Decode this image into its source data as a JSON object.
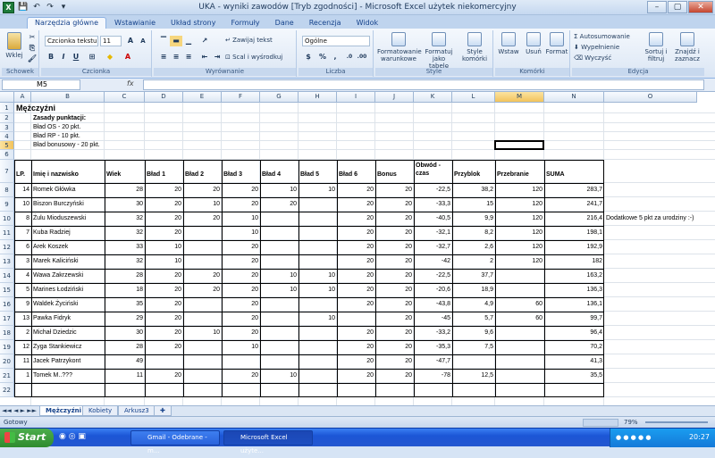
{
  "window": {
    "title": "UKA - wyniki zawodów  [Tryb zgodności] - Microsoft Excel użytek niekomercyjny",
    "app_icon": "X",
    "qat_icons": [
      "save-icon",
      "undo-icon",
      "redo-icon",
      "qat-dropdown-icon"
    ],
    "controls": [
      "–",
      "▢",
      "✕"
    ]
  },
  "ribbon": {
    "tabs": [
      "Narzędzia główne",
      "Wstawianie",
      "Układ strony",
      "Formuły",
      "Dane",
      "Recenzja",
      "Widok"
    ],
    "active_tab": 0,
    "paste_label": "Wklej",
    "clipboard_label": "Schowek",
    "font_name": "Czcionka tekstu",
    "font_size": "11",
    "font_label": "Czcionka",
    "align_label": "Wyrównanie",
    "wrap_label": "Zawijaj tekst",
    "merge_label": "Scal i wyśrodkuj",
    "number_format": "Ogólne",
    "number_label": "Liczba",
    "cond_format_label": "Formatowanie warunkowe",
    "format_table_label": "Formatuj jako tabelę",
    "cell_styles_label": "Style komórki",
    "styles_label": "Style",
    "insert_label": "Wstaw",
    "delete_label": "Usuń",
    "format_label": "Format",
    "cells_label": "Komórki",
    "autosum_label": "Autosumowanie",
    "fill_label": "Wypełnienie",
    "clear_label": "Wyczyść",
    "sort_label": "Sortuj i filtruj",
    "find_label": "Znajdź i zaznacz",
    "edit_label": "Edycja",
    "bold": "B",
    "italic": "I",
    "underline": "U"
  },
  "formula_bar": {
    "name_box": "M5",
    "fx": "fx",
    "value": ""
  },
  "columns": [
    "A",
    "B",
    "C",
    "D",
    "E",
    "F",
    "G",
    "H",
    "I",
    "J",
    "K",
    "L",
    "M",
    "N",
    "O"
  ],
  "selected_column": "M",
  "rows": [
    "1",
    "2",
    "3",
    "4",
    "5",
    "6",
    "7",
    "8",
    "9",
    "10",
    "11",
    "12",
    "13",
    "14",
    "15",
    "16",
    "17",
    "18",
    "19",
    "20",
    "21",
    "22"
  ],
  "selected_row": "5",
  "header_block": {
    "title": "Mężczyźni",
    "rules_title": "Zasady punktacji:",
    "rules": [
      "Bład OS - 20 pkt.",
      "Bład RP - 10 pkt.",
      "Bład bonusowy - 20 pkt."
    ]
  },
  "table": {
    "headers": [
      "LP.",
      "Imię i nazwisko",
      "Wiek",
      "Bład 1",
      "Bład 2",
      "Bład 3",
      "Bład 4",
      "Bład 5",
      "Bład 6",
      "Bonus",
      "Obwód - czas",
      "Przyblok",
      "Przebranie",
      "SUMA"
    ],
    "rows": [
      [
        "14",
        "Romek Główka",
        "28",
        "20",
        "20",
        "20",
        "10",
        "10",
        "20",
        "20",
        "-22,5",
        "38,2",
        "120",
        "283,7"
      ],
      [
        "10",
        "Biszon Burczyński",
        "30",
        "20",
        "10",
        "20",
        "20",
        "",
        "20",
        "20",
        "-33,3",
        "15",
        "120",
        "241,7"
      ],
      [
        "8",
        "Żulu Mioduszewski",
        "32",
        "20",
        "20",
        "10",
        "",
        "",
        "20",
        "20",
        "-40,5",
        "9,9",
        "120",
        "216,4"
      ],
      [
        "7",
        "Kuba Radziej",
        "32",
        "20",
        "",
        "10",
        "",
        "",
        "20",
        "20",
        "-32,1",
        "8,2",
        "120",
        "198,1"
      ],
      [
        "6",
        "Arek Koszek",
        "33",
        "10",
        "",
        "20",
        "",
        "",
        "20",
        "20",
        "-32,7",
        "2,6",
        "120",
        "192,9"
      ],
      [
        "3",
        "Marek Kaliciński",
        "32",
        "10",
        "",
        "20",
        "",
        "",
        "20",
        "20",
        "-42",
        "2",
        "120",
        "182"
      ],
      [
        "4",
        "Wawa Zakrzewski",
        "28",
        "20",
        "20",
        "20",
        "10",
        "10",
        "20",
        "20",
        "-22,5",
        "37,7",
        "",
        "163,2"
      ],
      [
        "5",
        "Marines Łodziński",
        "18",
        "20",
        "20",
        "20",
        "10",
        "10",
        "20",
        "20",
        "-20,6",
        "18,9",
        "",
        "136,3"
      ],
      [
        "9",
        "Waldek Życiński",
        "35",
        "20",
        "",
        "20",
        "",
        "",
        "20",
        "20",
        "-43,8",
        "4,9",
        "60",
        "136,1"
      ],
      [
        "13",
        "Pawka Fidryk",
        "29",
        "20",
        "",
        "20",
        "",
        "10",
        "",
        "20",
        "-45",
        "5,7",
        "60",
        "99,7"
      ],
      [
        "2",
        "Michał Dziedzic",
        "30",
        "20",
        "10",
        "20",
        "",
        "",
        "20",
        "20",
        "-33,2",
        "9,6",
        "",
        "96,4"
      ],
      [
        "12",
        "Zyga Stankiewicz",
        "28",
        "20",
        "",
        "10",
        "",
        "",
        "20",
        "20",
        "-35,3",
        "7,5",
        "",
        "70,2"
      ],
      [
        "11",
        "Jacek Patrzykont",
        "49",
        "",
        "",
        "",
        "",
        "",
        "20",
        "20",
        "-47,7",
        "",
        "",
        "41,3"
      ],
      [
        "1",
        "Tomek M..???",
        "11",
        "20",
        "",
        "20",
        "10",
        "",
        "20",
        "20",
        "-78",
        "12,5",
        "",
        "35,5"
      ]
    ],
    "note": "Dodatkowe 5 pkt za urodziny :-)"
  },
  "sheets": [
    "Mężczyźni",
    "Kobiety",
    "Arkusz3"
  ],
  "active_sheet": 0,
  "status": {
    "ready": "Gotowy",
    "zoom": "79%"
  },
  "taskbar": {
    "start": "Start",
    "items": [
      "Gmail - Odebrane - m...",
      "Microsoft Excel użyte..."
    ],
    "time": "20:27"
  }
}
